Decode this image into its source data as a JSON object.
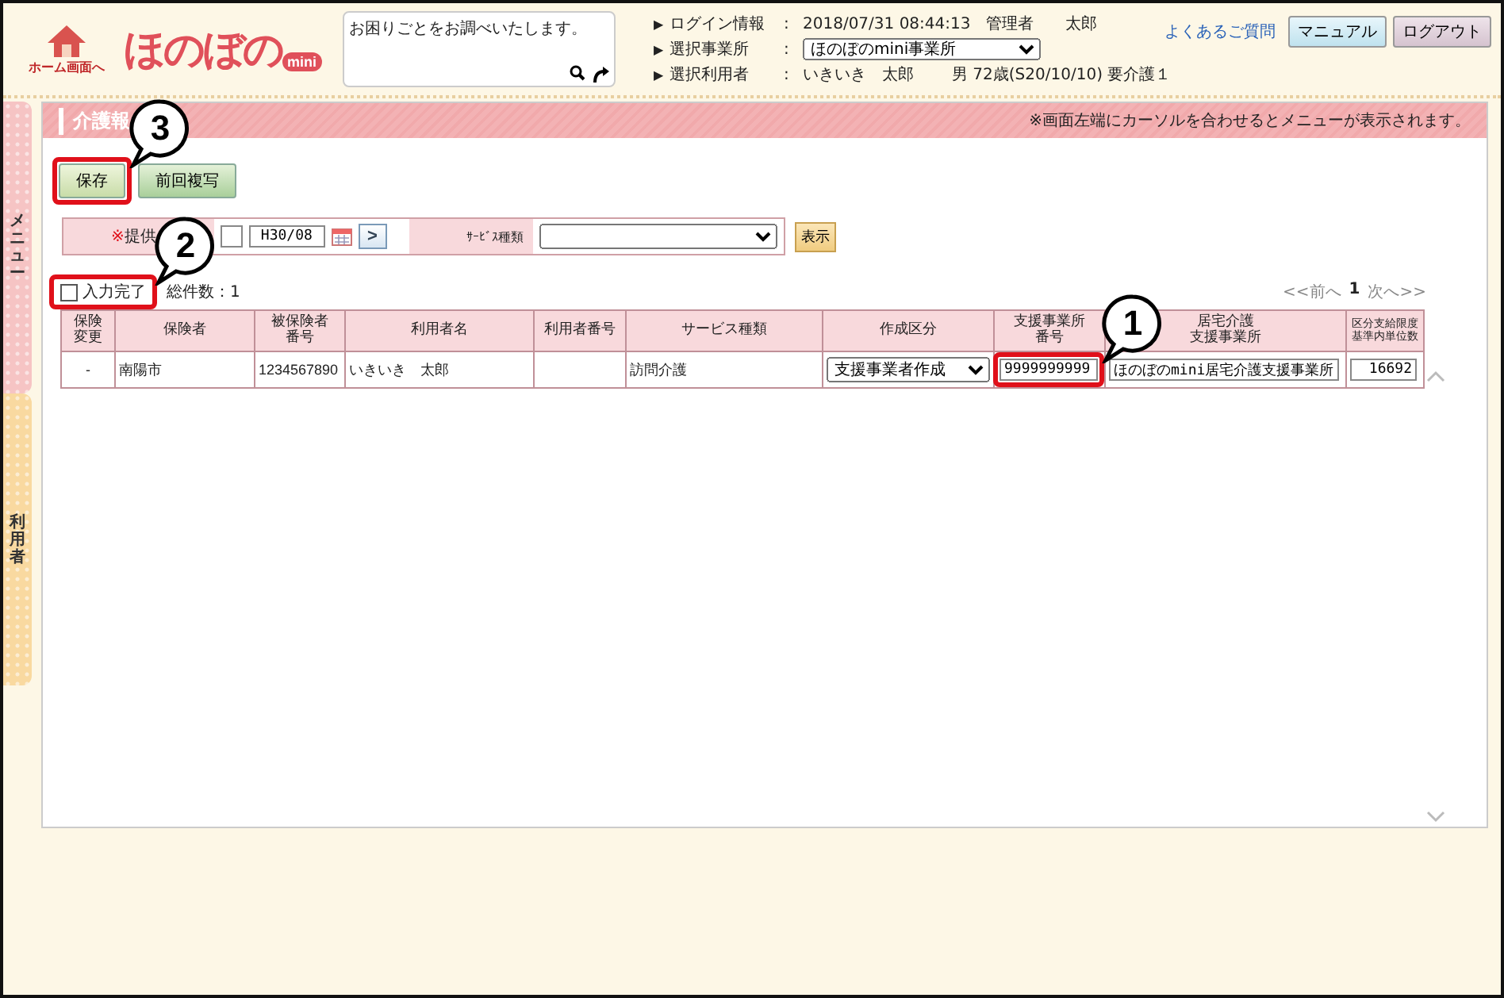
{
  "header": {
    "home_label": "ホーム画面へ",
    "logo": "ほのぼの",
    "logo_badge": "mini",
    "search_placeholder": "お困りごとをお調べいたします。",
    "info": [
      {
        "marker": "▶",
        "label": "ログイン情報",
        "sep": ":",
        "kind": "text",
        "value": "2018/07/31 08:44:13　管理者　　太郎"
      },
      {
        "marker": "▶",
        "label": "選択事業所",
        "sep": ":",
        "kind": "select",
        "value": "ほのぼのmini事業所"
      },
      {
        "marker": "▶",
        "label": "選択利用者",
        "sep": ":",
        "kind": "text",
        "value": "いきいき　太郎",
        "extra": "男 72歳(S20/10/10) 要介護１"
      }
    ],
    "faq_link": "よくあるご質問",
    "buttons": [
      {
        "label": "マニュアル",
        "kind": "manual"
      },
      {
        "label": "ログアウト",
        "kind": "logout"
      }
    ]
  },
  "side_tabs": [
    {
      "label": "メニュー",
      "color": "#f6c4c4"
    },
    {
      "label": "利用者",
      "color": "#f9d9a0"
    }
  ],
  "panel": {
    "title": "介護報",
    "notice": "※画面左端にカーソルを合わせるとメニューが表示されます。",
    "actions": [
      {
        "label": "保存",
        "callout": "3"
      },
      {
        "label": "前回複写"
      }
    ],
    "filter": {
      "required_mark": "※",
      "period_label": "提供",
      "period_value": "H30/08",
      "next": ">",
      "service_label": "ｻｰﾋﾞｽ種類",
      "show_button": "表示"
    },
    "complete": {
      "label": "入力完了",
      "checked": false,
      "callout": "2"
    },
    "total": "総件数：1",
    "pager": {
      "prev": "<<前へ",
      "page": "1",
      "next": "次へ>>"
    },
    "table": {
      "columns": [
        {
          "lines": [
            "保険",
            "変更"
          ]
        },
        {
          "lines": [
            "保険者"
          ]
        },
        {
          "lines": [
            "被保険者",
            "番号"
          ]
        },
        {
          "lines": [
            "利用者名"
          ]
        },
        {
          "lines": [
            "利用者番号"
          ]
        },
        {
          "lines": [
            "サービス種類"
          ]
        },
        {
          "lines": [
            "作成区分"
          ]
        },
        {
          "lines": [
            "支援事業所",
            "番号"
          ]
        },
        {
          "lines": [
            "居宅介護",
            "支援事業所"
          ]
        },
        {
          "lines": [
            "区分支給限度",
            "基準内単位数"
          ]
        }
      ],
      "rows": [
        [
          {
            "kind": "text",
            "text": "-"
          },
          {
            "kind": "text",
            "text": "南陽市"
          },
          {
            "kind": "text",
            "text": "1234567890"
          },
          {
            "kind": "text",
            "text": "いきいき　太郎"
          },
          {
            "kind": "blank"
          },
          {
            "kind": "text",
            "text": "訪問介護"
          },
          {
            "kind": "select",
            "text": "支援事業者作成"
          },
          {
            "kind": "input",
            "text": "9999999999",
            "callout": "1"
          },
          {
            "kind": "input",
            "text": "ほのぼのmini居宅介護支援事業所"
          },
          {
            "kind": "input",
            "text": "16692"
          }
        ]
      ]
    }
  }
}
